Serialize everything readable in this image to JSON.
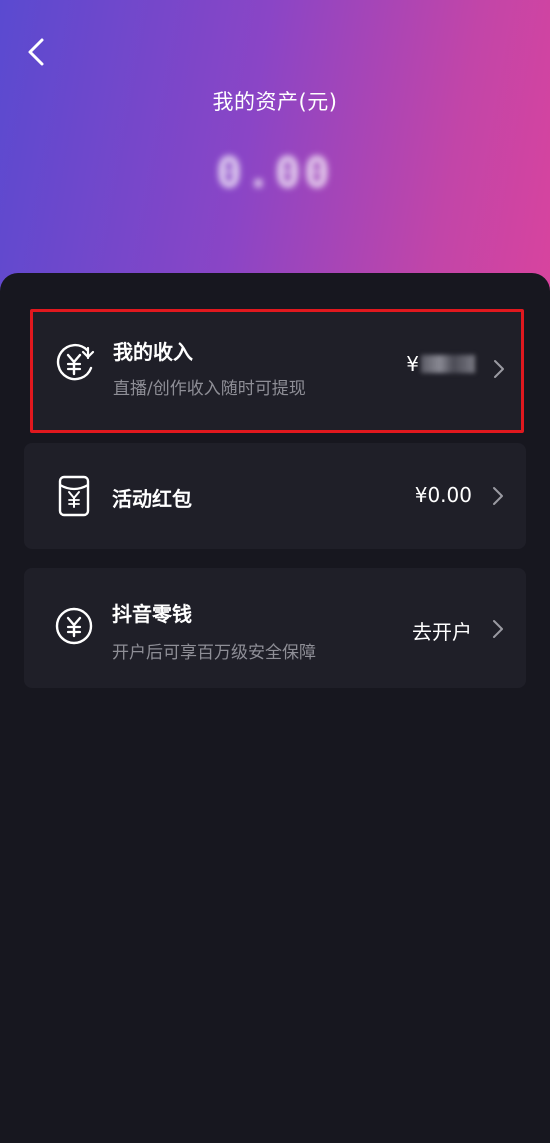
{
  "header": {
    "title": "我的资产(元)",
    "amount": "0.00"
  },
  "items": [
    {
      "title": "我的收入",
      "subtitle": "直播/创作收入随时可提现",
      "value_prefix": "¥",
      "icon": "yen-income-icon"
    },
    {
      "title": "活动红包",
      "value": "¥0.00",
      "icon": "red-packet-icon"
    },
    {
      "title": "抖音零钱",
      "subtitle": "开户后可享百万级安全保障",
      "value": "去开户",
      "icon": "yen-circle-icon"
    }
  ],
  "colors": {
    "header_gradient_start": "#5a4ad0",
    "header_gradient_end": "#d8449e",
    "background": "#16161e",
    "card": "#1f1f28",
    "highlight_border": "#e0181e",
    "subtext": "#8e8e96"
  }
}
